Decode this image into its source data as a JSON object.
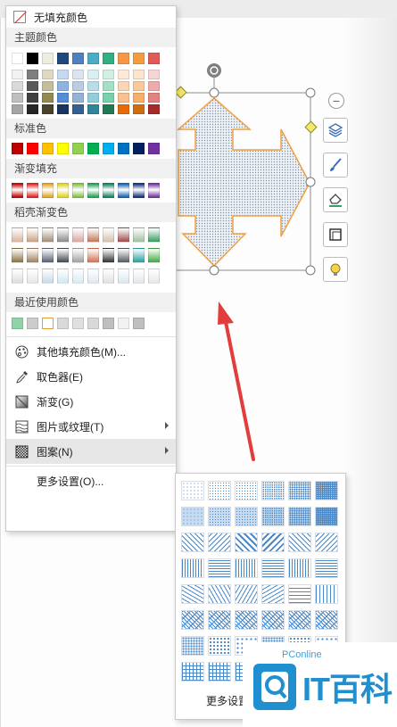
{
  "fill_menu": {
    "no_fill": "无填充颜色",
    "theme_colors_header": "主题颜色",
    "theme_colors_top": [
      "#ffffff",
      "#000000",
      "#eeece1",
      "#1f497d",
      "#4f81bd",
      "#4bacc6",
      "#2fb182",
      "#f79646",
      "#f59d3d",
      "#e05a5a"
    ],
    "theme_tones": [
      [
        "#f2f2f2",
        "#d9d9d9",
        "#bfbfbf",
        "#a6a6a6"
      ],
      [
        "#7f7f7f",
        "#595959",
        "#404040",
        "#262626"
      ],
      [
        "#ddd9c3",
        "#c4bd97",
        "#938953",
        "#494429"
      ],
      [
        "#c6d9f0",
        "#8db3e2",
        "#548dd4",
        "#17365d"
      ],
      [
        "#dbe5f1",
        "#b8cce4",
        "#95b3d7",
        "#366092"
      ],
      [
        "#dbeef3",
        "#b7dde8",
        "#92cddc",
        "#31859b"
      ],
      [
        "#d1f0e3",
        "#a3e1c7",
        "#75d2ab",
        "#1f7a55"
      ],
      [
        "#fde9d9",
        "#fbd5b5",
        "#fac08f",
        "#e36c09"
      ],
      [
        "#fde4cc",
        "#fbc999",
        "#f9ad66",
        "#d06d10"
      ],
      [
        "#f6d5d5",
        "#edabab",
        "#e48181",
        "#a52a2a"
      ]
    ],
    "standard_header": "标准色",
    "standard_colors": [
      "#c00000",
      "#ff0000",
      "#ffc000",
      "#ffff00",
      "#92d050",
      "#00b050",
      "#00b0f0",
      "#0070c0",
      "#002060",
      "#7030a0"
    ],
    "gradient_header": "渐变填充",
    "gradient_colors": [
      "#c00000",
      "#e02020",
      "#e6a020",
      "#e0d020",
      "#80c040",
      "#20a050",
      "#108060",
      "#1060b0",
      "#103080",
      "#7030a0"
    ],
    "shell_gradient_header": "稻壳渐变色",
    "shell_gradient_rows": [
      [
        "#d8b4a0",
        "#c9a385",
        "#9e8e78",
        "#8a8a8a",
        "#d9a5a0",
        "#c1785a",
        "#d4c0b0",
        "#9e4a4a",
        "#a0c0a0",
        "#3a9a60"
      ],
      [
        "#8a7040",
        "#a08060",
        "#556070",
        "#404850",
        "#a0a0a0",
        "#d07050",
        "#303030",
        "#505a60",
        "#20a0a0",
        "#40aa40"
      ],
      [
        "#dddddd",
        "#e6e6e6",
        "#c8d8e8",
        "#d0e8f0",
        "#d8eaf0",
        "#e0e8f0",
        "#e0e0e0",
        "#d8e8f0",
        "#e0e8e8",
        "#e8e8e8"
      ]
    ],
    "recent_header": "最近使用颜色",
    "recent_colors": [
      "#8fd3a8",
      "#cccccc",
      "#ffffff",
      "#d9d9d9",
      "#e0e0e0",
      "#d9d9d9",
      "#bfbfbf",
      "#f2f2f2",
      "#bfbfbf"
    ],
    "items": [
      {
        "label": "其他填充颜色(M)...",
        "icon": "palette-icon"
      },
      {
        "label": "取色器(E)",
        "icon": "eyedropper-icon"
      },
      {
        "label": "渐变(G)",
        "icon": "gradient-icon"
      },
      {
        "label": "图片或纹理(T)",
        "icon": "picture-texture-icon",
        "has_submenu": true
      },
      {
        "label": "图案(N)",
        "icon": "pattern-icon",
        "has_submenu": true,
        "active": true
      }
    ],
    "more_settings": "更多设置(O)..."
  },
  "pattern_submenu": {
    "pattern_count": 48,
    "more_settings": "更多设置"
  },
  "side_tools": [
    "layers-icon",
    "brush-icon",
    "shape-outline-icon",
    "frame-icon",
    "lightbulb-icon"
  ],
  "watermark": {
    "small": "PConline",
    "large": "IT百科"
  },
  "colors": {
    "shape_outline": "#f0a040",
    "pattern_blue": "#4a88c8",
    "arrow_red": "#e23c3c"
  }
}
